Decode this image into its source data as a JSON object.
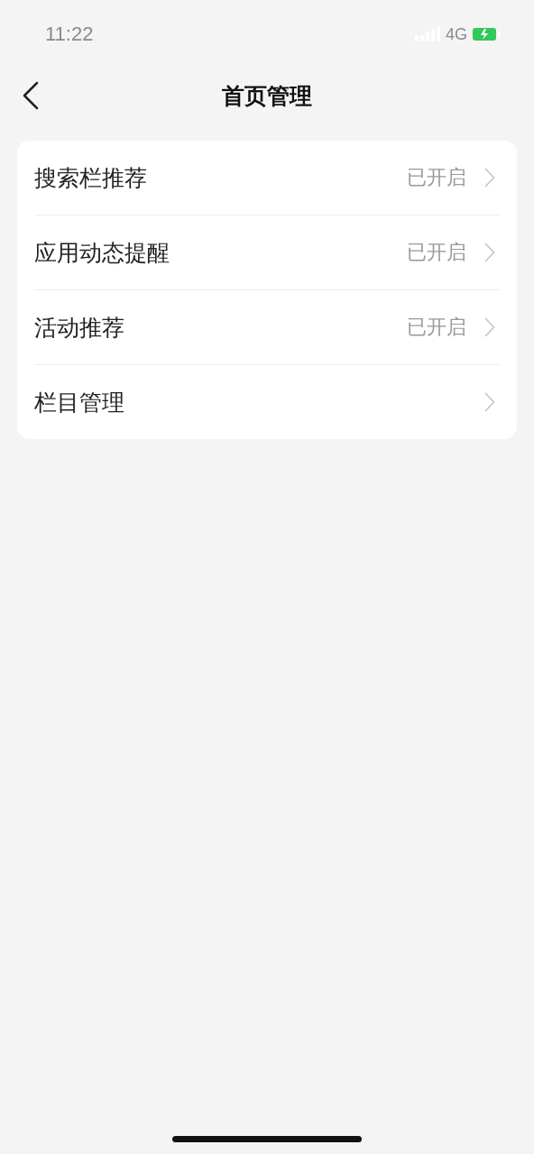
{
  "status_bar": {
    "time": "11:22",
    "network": "4G"
  },
  "nav": {
    "title": "首页管理"
  },
  "settings": [
    {
      "label": "搜索栏推荐",
      "value": "已开启"
    },
    {
      "label": "应用动态提醒",
      "value": "已开启"
    },
    {
      "label": "活动推荐",
      "value": "已开启"
    },
    {
      "label": "栏目管理"
    }
  ]
}
